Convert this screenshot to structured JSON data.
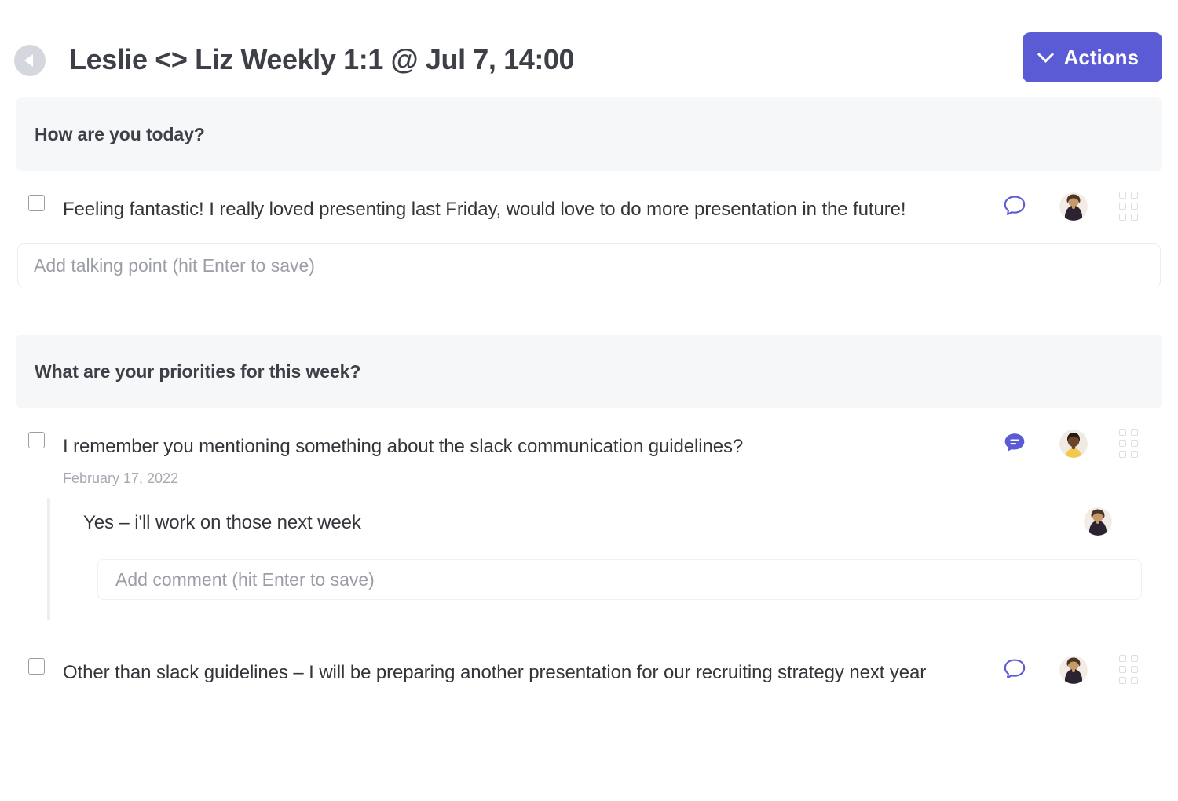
{
  "header": {
    "back_icon": "back-arrow-icon",
    "title": "Leslie <> Liz Weekly 1:1 @ Jul 7, 14:00",
    "actions_label": "Actions",
    "actions_chevron_icon": "chevron-down-icon",
    "accent_color": "#5b5bd6"
  },
  "sections": [
    {
      "heading": "How are you today?",
      "talking_points": [
        {
          "text": "Feeling fantastic! I really loved presenting last Friday, would love to do more presentation in the future!",
          "date": "",
          "comment_icon": "comment-outline-icon",
          "has_comments": false,
          "avatar": "avatar-dark-top",
          "drag_icon": "drag-handle-icon"
        }
      ],
      "add_input_placeholder": "Add talking point (hit Enter to save)"
    },
    {
      "heading": "What are your priorities for this week?",
      "talking_points": [
        {
          "text": "I remember you mentioning something about the slack communication guidelines?",
          "date": "February 17, 2022",
          "comment_icon": "comment-filled-icon",
          "has_comments": true,
          "avatar": "avatar-yellow-top",
          "drag_icon": "drag-handle-icon",
          "thread": {
            "comments": [
              {
                "text": "Yes – i'll work on those next week",
                "avatar": "avatar-dark-top"
              }
            ],
            "add_comment_placeholder": "Add comment (hit Enter to save)"
          }
        },
        {
          "text": "Other than slack guidelines – I will be preparing another presentation for our recruiting strategy next year",
          "date": "",
          "comment_icon": "comment-outline-icon",
          "has_comments": false,
          "avatar": "avatar-dark-top",
          "drag_icon": "drag-handle-icon"
        }
      ]
    }
  ]
}
